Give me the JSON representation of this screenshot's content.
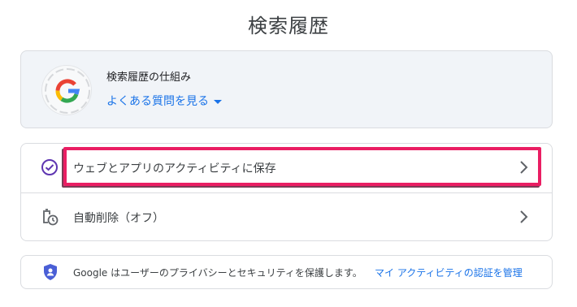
{
  "page": {
    "title": "検索履歴"
  },
  "info": {
    "title": "検索履歴の仕組み",
    "faq_link": "よくある質問を見る"
  },
  "settings": {
    "rows": [
      {
        "label": "ウェブとアプリのアクティビティに保存",
        "icon": "check-circle-icon",
        "highlighted": true
      },
      {
        "label": "自動削除（オフ）",
        "icon": "auto-delete-icon"
      }
    ]
  },
  "privacy": {
    "text": "Google はユーザーのプライバシーとセキュリティを保護します。",
    "link": "マイ アクティビティの認証を管理"
  },
  "colors": {
    "accent": "#1a73e8",
    "highlight": "#ea1e63",
    "check": "#5e35b1",
    "card_bg": "#f1f4f8"
  }
}
